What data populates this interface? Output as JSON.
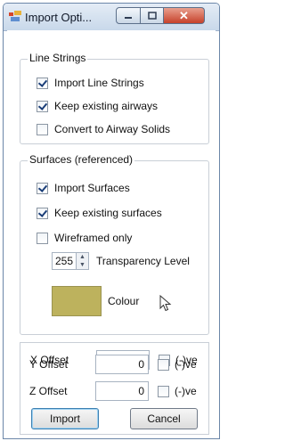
{
  "window": {
    "title": "Import Opti...",
    "minimize_icon": "minimize-icon",
    "maximize_icon": "maximize-icon",
    "close_icon": "close-icon",
    "close_glyph": "✕"
  },
  "line_strings": {
    "title": "Line Strings",
    "items": [
      {
        "label": "Import Line Strings",
        "checked": true
      },
      {
        "label": "Keep existing airways",
        "checked": true
      },
      {
        "label": "Convert to Airway Solids",
        "checked": false
      }
    ]
  },
  "surfaces": {
    "title": "Surfaces (referenced)",
    "items": [
      {
        "label": "Import Surfaces",
        "checked": true
      },
      {
        "label": "Keep existing surfaces",
        "checked": true
      },
      {
        "label": "Wireframed only",
        "checked": false
      }
    ],
    "transparency_value": "255",
    "transparency_label": "Transparency Level",
    "colour_label": "Colour",
    "colour_swatch": "#bdb25d"
  },
  "offsets": [
    {
      "label": "X Offset",
      "value": "0",
      "ve_label": "(-)ve",
      "checked": false
    },
    {
      "label": "Y Offset",
      "value": "0",
      "ve_label": "(-)ve",
      "checked": false
    },
    {
      "label": "Z Offset",
      "value": "0",
      "ve_label": "(-)ve",
      "checked": false
    }
  ],
  "buttons": {
    "import": "Import",
    "cancel": "Cancel"
  }
}
